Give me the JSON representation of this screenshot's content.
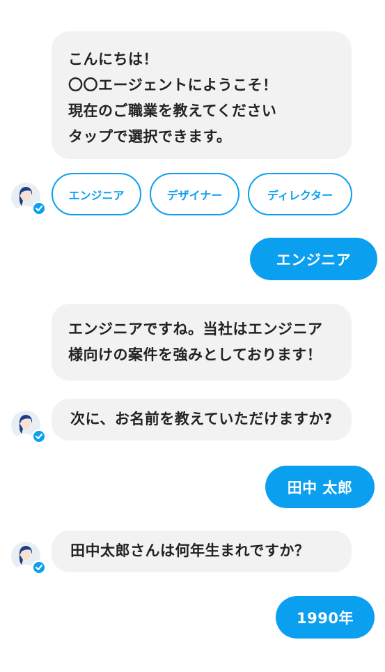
{
  "colors": {
    "accent": "#0b9ff0",
    "bot_bubble_bg": "#f2f2f2",
    "text": "#222222"
  },
  "messages": {
    "m1": [
      "こんにちは！",
      "〇〇エージェントにようこそ！",
      "現在のご職業を教えてください",
      "タップで選択できます。"
    ],
    "options": [
      "エンジニア",
      "デザイナー",
      "ディレクター"
    ],
    "r1": "エンジニア",
    "m2": [
      "エンジニアですね。当社はエンジニア",
      "様向けの案件を強みとしております！"
    ],
    "m3": "次に、お名前を教えていただけますか?",
    "r2": "田中 太郎",
    "m4": "田中太郎さんは何年生まれですか？",
    "r3": "1990年"
  },
  "icons": {
    "avatar": "female-operator-avatar",
    "verified": "check-badge-icon"
  }
}
